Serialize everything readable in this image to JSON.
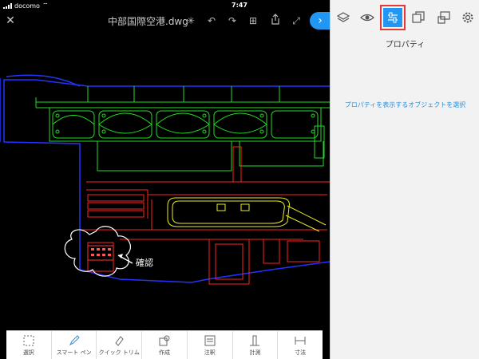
{
  "status_bar": {
    "carrier": "docomo",
    "time": "7:47",
    "battery_level": 0.9
  },
  "toolbar": {
    "document_title": "中部国際空港.dwg"
  },
  "drawing": {
    "callout_label": "確認"
  },
  "bottom_tools": [
    {
      "label": "選択"
    },
    {
      "label": "スマート ペン"
    },
    {
      "label": "クイック トリム"
    },
    {
      "label": "作成"
    },
    {
      "label": "注釈"
    },
    {
      "label": "計測"
    },
    {
      "label": "寸法"
    }
  ],
  "panel": {
    "heading": "プロパティ",
    "hint": "プロパティを表示するオブジェクトを選択",
    "active_tab": "properties"
  },
  "colors": {
    "accent": "#2196f3",
    "highlight": "#e53935",
    "link": "#2a8fd8"
  }
}
